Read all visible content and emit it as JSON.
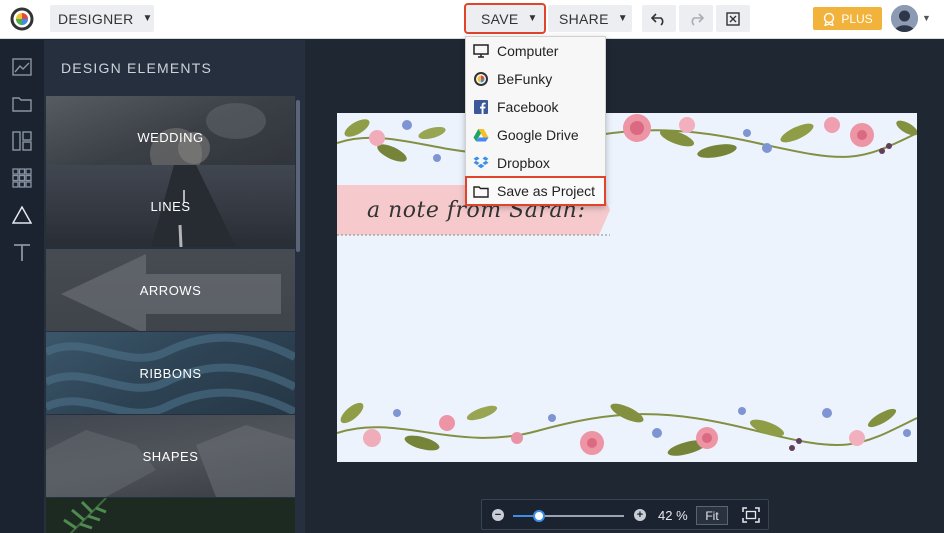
{
  "toolbar": {
    "designer_label": "DESIGNER",
    "save_label": "SAVE",
    "share_label": "SHARE",
    "plus_label": "PLUS",
    "icons": {
      "logo": "befunky-logo-icon",
      "undo": "undo-icon",
      "redo": "redo-icon",
      "close": "close-x-icon",
      "plus": "plus-badge-icon"
    }
  },
  "save_menu": {
    "items": [
      {
        "label": "Computer",
        "icon": "computer-icon"
      },
      {
        "label": "BeFunky",
        "icon": "befunky-icon"
      },
      {
        "label": "Facebook",
        "icon": "facebook-icon"
      },
      {
        "label": "Google Drive",
        "icon": "google-drive-icon"
      },
      {
        "label": "Dropbox",
        "icon": "dropbox-icon"
      },
      {
        "label": "Save as Project",
        "icon": "folder-icon"
      }
    ]
  },
  "sidebar": {
    "icons": [
      "chart-icon",
      "folder-icon",
      "layout-icon",
      "grid-icon",
      "triangle-icon",
      "text-icon"
    ]
  },
  "panel": {
    "title": "DESIGN ELEMENTS",
    "tiles": [
      {
        "label": "WEDDING"
      },
      {
        "label": "LINES"
      },
      {
        "label": "ARROWS"
      },
      {
        "label": "RIBBONS"
      },
      {
        "label": "SHAPES"
      },
      {
        "label": ""
      }
    ]
  },
  "canvas": {
    "ribbon_text": "a note from Sarah:"
  },
  "zoom": {
    "value_label": "42 %",
    "fit_label": "Fit",
    "level": 0.23
  },
  "colors": {
    "accent": "#3d8fe6",
    "highlight": "#e0452c",
    "plus": "#f1b33b",
    "canvas_bg": "#edf3fd"
  }
}
